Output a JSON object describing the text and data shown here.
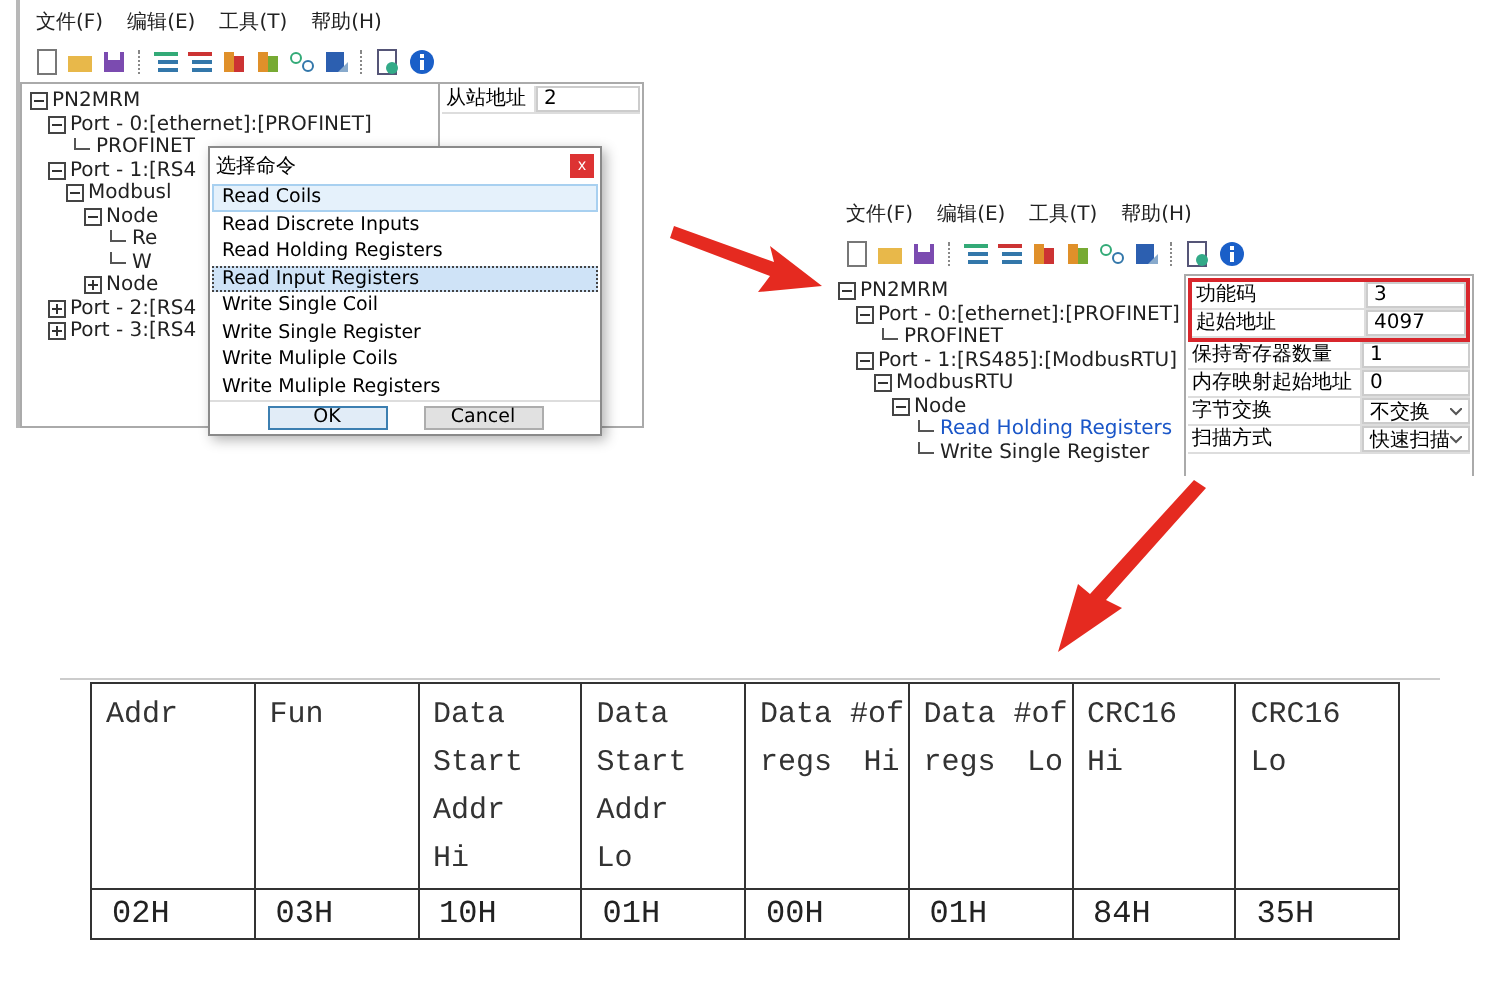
{
  "screenshot_1": {
    "menu": [
      "文件(F)",
      "编辑(E)",
      "工具(T)",
      "帮助(H)"
    ],
    "tree": [
      {
        "label": "PN2MRM",
        "expanded": true,
        "children": [
          {
            "label": "Port - 0:[ethernet]:[PROFINET]",
            "expanded": true,
            "children": [
              {
                "label": "PROFINET"
              }
            ]
          },
          {
            "label": "Port - 1:[RS4",
            "expanded": true,
            "children": [
              {
                "label": "Modbusl",
                "expanded": true,
                "children": [
                  {
                    "label": "Node",
                    "expanded": true,
                    "children": [
                      {
                        "label": "Re"
                      },
                      {
                        "label": "W"
                      }
                    ]
                  },
                  {
                    "label": "Node",
                    "expanded": false
                  }
                ]
              }
            ]
          },
          {
            "label": "Port - 2:[RS4",
            "expanded": false
          },
          {
            "label": "Port - 3:[RS4",
            "expanded": false
          }
        ]
      }
    ],
    "properties": [
      {
        "label": "从站地址",
        "value": "2"
      }
    ],
    "dialog": {
      "title": "选择命令",
      "close": "x",
      "commands": [
        {
          "label": "Read Coils",
          "selected": false,
          "highlighted": true
        },
        {
          "label": "Read Discrete Inputs",
          "selected": false,
          "highlighted": false
        },
        {
          "label": "Read Holding Registers",
          "selected": false,
          "highlighted": false
        },
        {
          "label": "Read Input Registers",
          "selected": true,
          "highlighted": false
        },
        {
          "label": "Write Single Coil",
          "selected": false,
          "highlighted": false
        },
        {
          "label": "Write Single Register",
          "selected": false,
          "highlighted": false
        },
        {
          "label": "Write Muliple Coils",
          "selected": false,
          "highlighted": false
        },
        {
          "label": "Write Muliple Registers",
          "selected": false,
          "highlighted": false
        }
      ],
      "buttons": [
        "OK",
        "Cancel"
      ]
    }
  },
  "screenshot_2": {
    "menu": [
      "文件(F)",
      "编辑(E)",
      "工具(T)",
      "帮助(H)"
    ],
    "tree": [
      {
        "label": "PN2MRM",
        "expanded": true,
        "selected": false,
        "children": [
          {
            "label": "Port - 0:[ethernet]:[PROFINET]",
            "expanded": true,
            "selected": false,
            "children": [
              {
                "label": "PROFINET",
                "selected": false
              }
            ]
          },
          {
            "label": "Port - 1:[RS485]:[ModbusRTU]",
            "expanded": true,
            "selected": false,
            "children": [
              {
                "label": "ModbusRTU",
                "expanded": true,
                "selected": false,
                "children": [
                  {
                    "label": "Node",
                    "expanded": true,
                    "selected": false,
                    "children": [
                      {
                        "label": "Read Holding Registers",
                        "selected": true
                      },
                      {
                        "label": "Write Single Register",
                        "selected": false
                      }
                    ]
                  }
                ]
              }
            ]
          }
        ]
      }
    ],
    "properties": [
      {
        "label": "功能码",
        "value": "3",
        "kind": "text",
        "highlighted": true
      },
      {
        "label": "起始地址",
        "value": "4097",
        "kind": "text",
        "highlighted": true
      },
      {
        "label": "保持寄存器数量",
        "value": "1",
        "kind": "text",
        "highlighted": false
      },
      {
        "label": "内存映射起始地址",
        "value": "0",
        "kind": "text",
        "highlighted": false
      },
      {
        "label": "字节交换",
        "value": "不交换",
        "kind": "select",
        "highlighted": false
      },
      {
        "label": "扫描方式",
        "value": "快速扫描",
        "kind": "select",
        "highlighted": false
      }
    ]
  },
  "table": {
    "header": [
      [
        "Addr"
      ],
      [
        "Fun"
      ],
      [
        "Data",
        "Start",
        "Addr",
        "Hi"
      ],
      [
        "Data",
        "Start",
        "Addr",
        "Lo"
      ],
      [
        "Data #of",
        "regs Hi"
      ],
      [
        "Data #of",
        "regs Lo"
      ],
      [
        "CRC16",
        "Hi"
      ],
      [
        "CRC16",
        "Lo"
      ]
    ],
    "row": [
      "02H",
      "03H",
      "10H",
      "01H",
      "00H",
      "01H",
      "84H",
      "35H"
    ]
  }
}
